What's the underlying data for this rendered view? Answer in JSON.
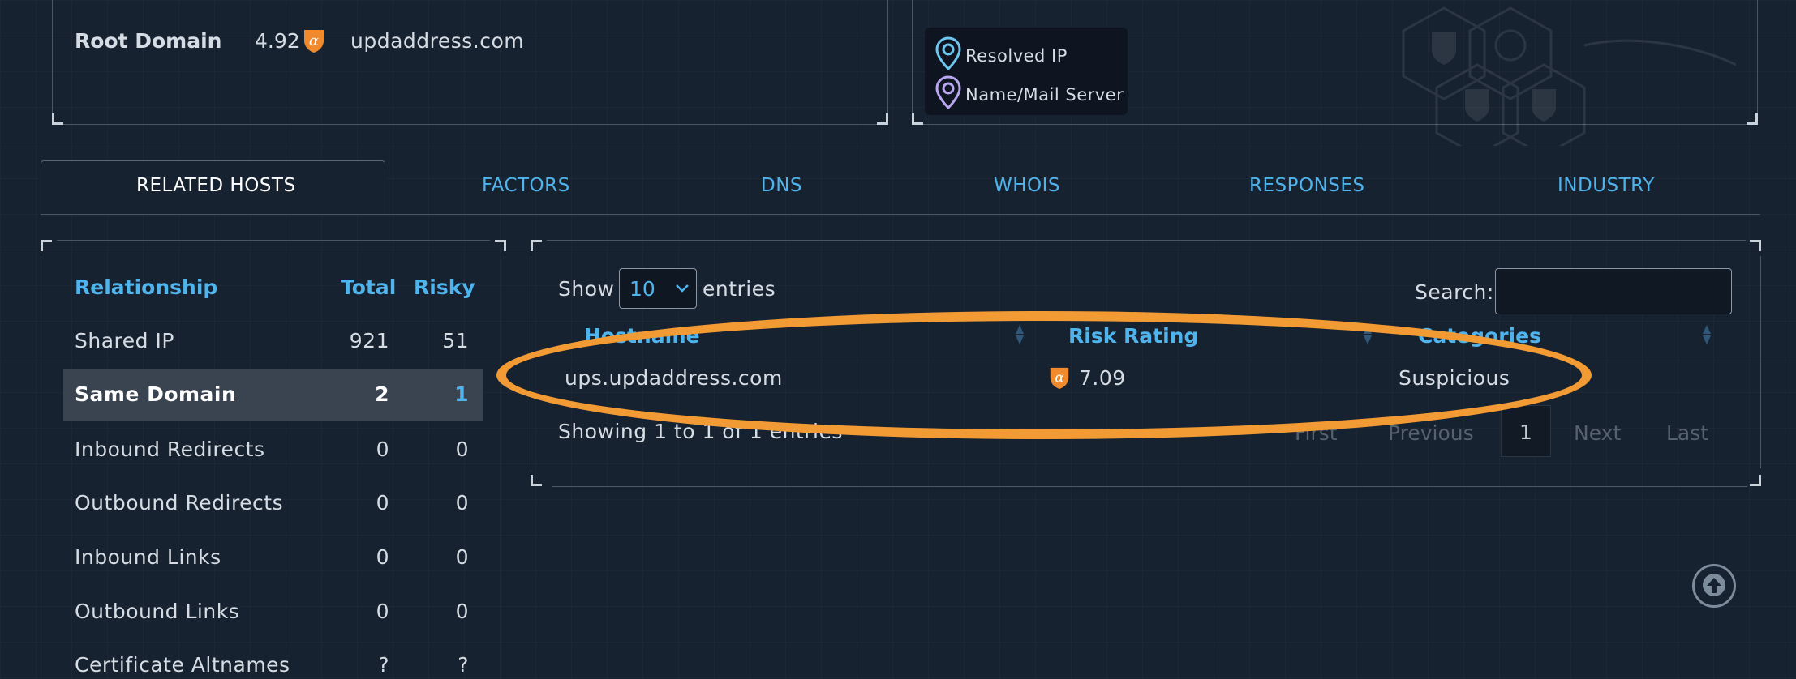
{
  "summary": {
    "root_label": "Root Domain",
    "root_score": "4.92",
    "root_domain": "updaddress.com"
  },
  "legend": {
    "items": [
      {
        "label": "Resolved IP",
        "color": "#6ec6f0"
      },
      {
        "label": "Name/Mail Server",
        "color": "#b9a7f2"
      }
    ]
  },
  "tabs": [
    {
      "label": "RELATED HOSTS"
    },
    {
      "label": "FACTORS"
    },
    {
      "label": "DNS"
    },
    {
      "label": "WHOIS"
    },
    {
      "label": "RESPONSES"
    },
    {
      "label": "INDUSTRY"
    }
  ],
  "relationships": {
    "headers": {
      "relationship": "Relationship",
      "total": "Total",
      "risky": "Risky"
    },
    "rows": [
      {
        "label": "Shared IP",
        "total": "921",
        "risky": "51"
      },
      {
        "label": "Same Domain",
        "total": "2",
        "risky": "1"
      },
      {
        "label": "Inbound Redirects",
        "total": "0",
        "risky": "0"
      },
      {
        "label": "Outbound Redirects",
        "total": "0",
        "risky": "0"
      },
      {
        "label": "Inbound Links",
        "total": "0",
        "risky": "0"
      },
      {
        "label": "Outbound Links",
        "total": "0",
        "risky": "0"
      },
      {
        "label": "Certificate Altnames",
        "total": "?",
        "risky": "?"
      }
    ]
  },
  "hosts_table": {
    "show_label": "Show",
    "entries_value": "10",
    "entries_label": "entries",
    "search_label": "Search:",
    "search_value": "",
    "headers": {
      "hostname": "Hostname",
      "risk_rating": "Risk Rating",
      "categories": "Categories"
    },
    "rows": [
      {
        "hostname": "ups.updaddress.com",
        "risk_rating": "7.09",
        "category": "Suspicious"
      }
    ],
    "info": "Showing 1 to 1 of 1 entries",
    "pagination": {
      "first": "First",
      "previous": "Previous",
      "current": "1",
      "next": "Next",
      "last": "Last"
    }
  },
  "colors": {
    "accent": "#4fb3ec",
    "highlight_ring": "#f29a33",
    "alpha_badge": "#f08a2c"
  }
}
